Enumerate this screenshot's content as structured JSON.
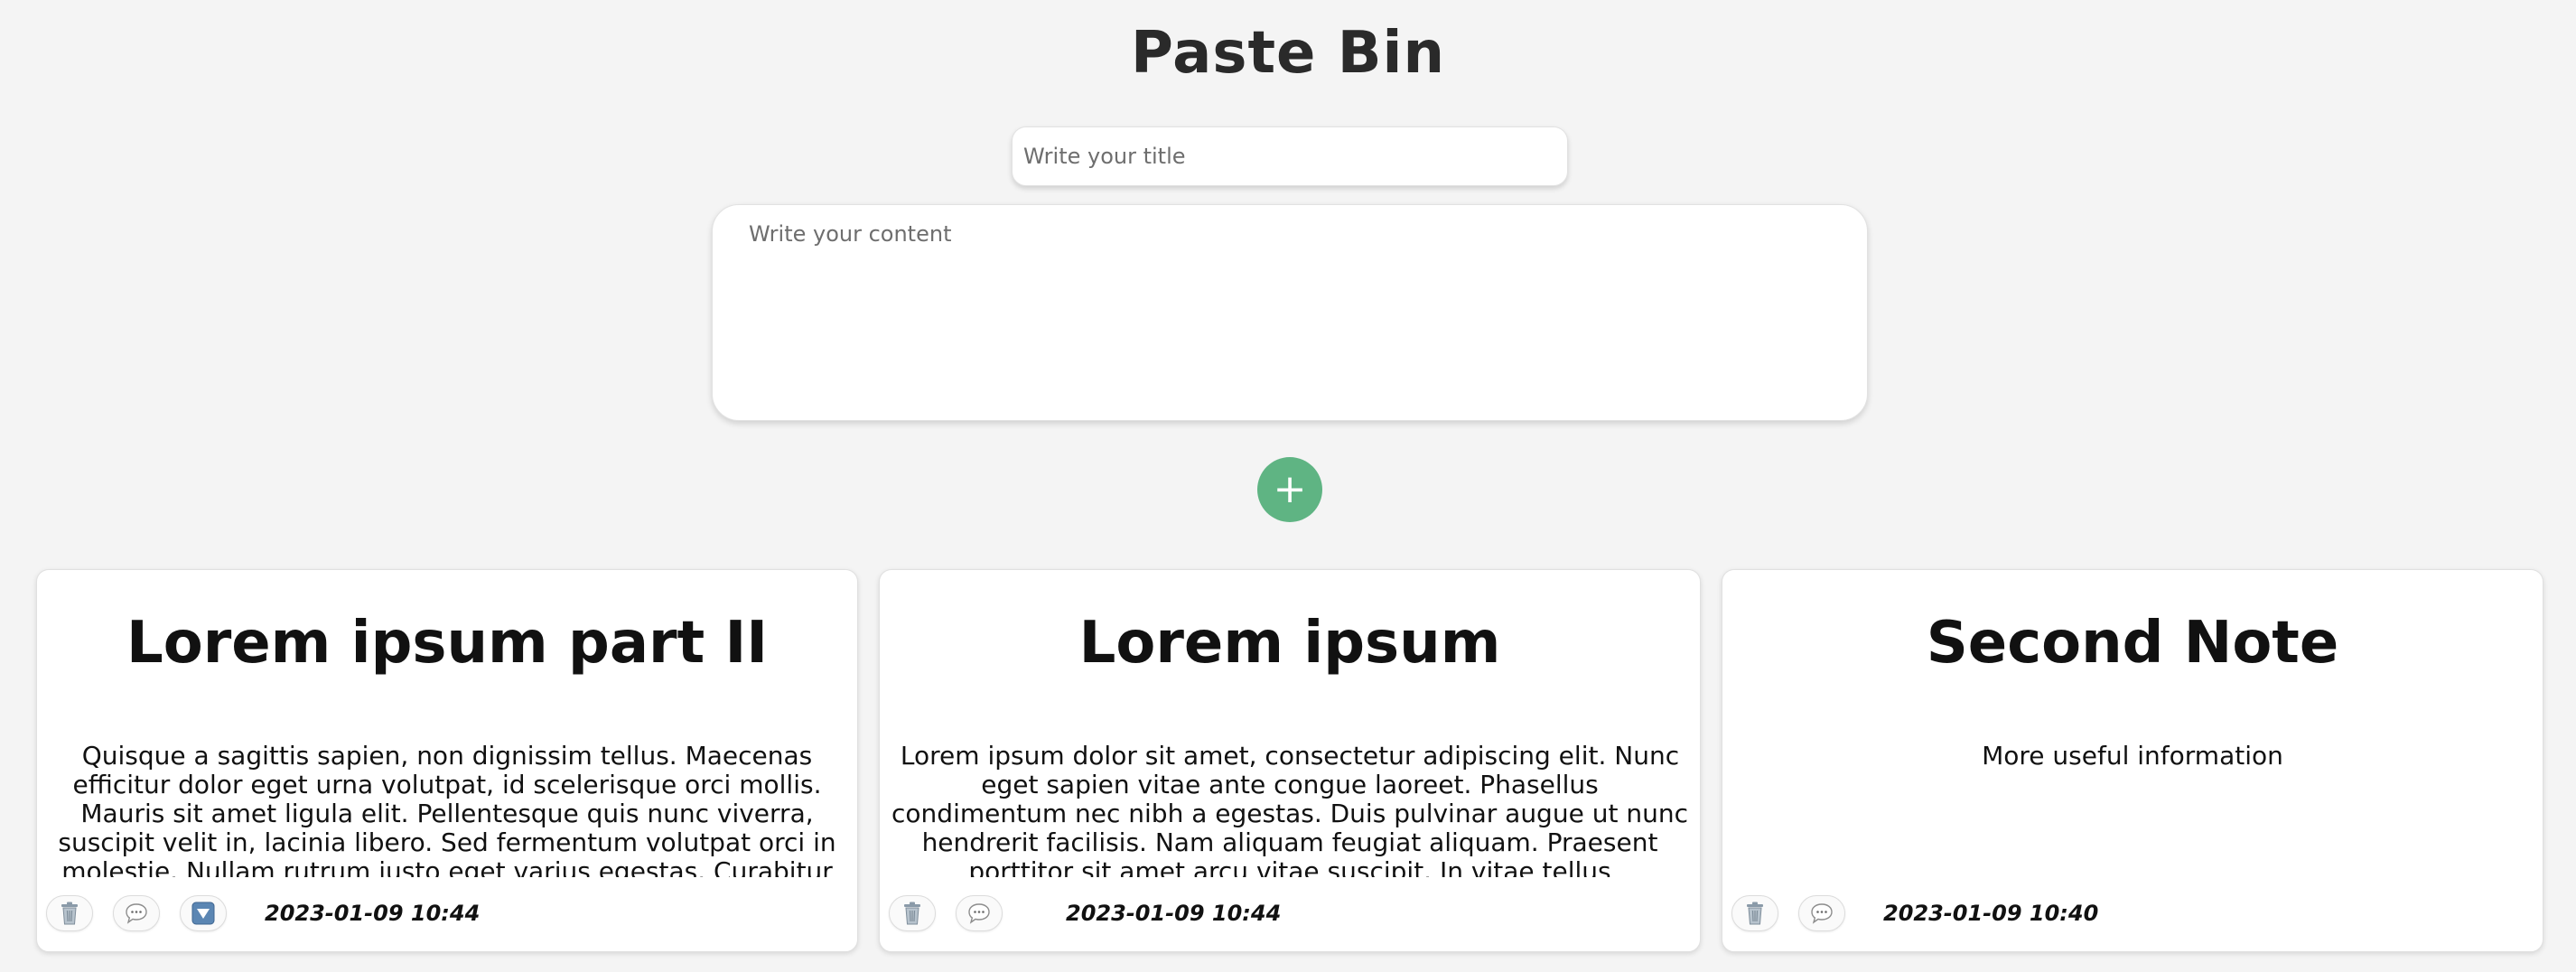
{
  "header": {
    "title": "Paste Bin"
  },
  "form": {
    "title_placeholder": "Write your title",
    "content_placeholder": "Write your content",
    "add_label": "+"
  },
  "colors": {
    "background": "#f4f4f4",
    "add_button": "#5fb483",
    "card_background": "#ffffff"
  },
  "icons": {
    "delete": "trash-can-icon",
    "comment": "speech-bubble-icon",
    "expand": "down-arrow-icon"
  },
  "notes": [
    {
      "title": "Lorem ipsum part II",
      "content": "Quisque a sagittis sapien, non dignissim tellus. Maecenas efficitur dolor eget urna volutpat, id scelerisque orci mollis. Mauris sit amet ligula elit. Pellentesque quis nunc viverra, suscipit velit in, lacinia libero. Sed fermentum volutpat orci in molestie. Nullam rutrum justo eget varius egestas. Curabitur",
      "date": "2023-01-09 10:44",
      "has_expand": true
    },
    {
      "title": "Lorem ipsum",
      "content": "Lorem ipsum dolor sit amet, consectetur adipiscing elit. Nunc eget sapien vitae ante congue laoreet. Phasellus condimentum nec nibh a egestas. Duis pulvinar augue ut nunc hendrerit facilisis. Nam aliquam feugiat aliquam. Praesent porttitor sit amet arcu vitae suscipit. In vitae tellus",
      "date": "2023-01-09 10:44",
      "has_expand": false
    },
    {
      "title": "Second Note",
      "content": "More useful information",
      "date": "2023-01-09 10:40",
      "has_expand": false
    }
  ]
}
